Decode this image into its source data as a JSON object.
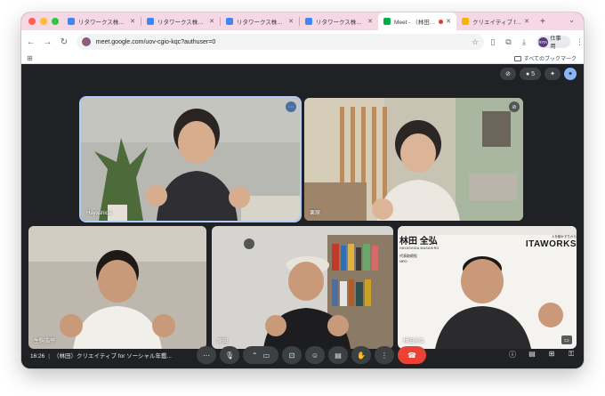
{
  "colors": {
    "tab_strip": "#f6d8e4",
    "meet_bg": "#202124",
    "control_bg": "#3c4043",
    "end_call": "#ea4335",
    "speaking_outline": "#aecbfa"
  },
  "window_controls": [
    {
      "name": "close",
      "color": "#ff5f57"
    },
    {
      "name": "minimize",
      "color": "#febc2e"
    },
    {
      "name": "zoom",
      "color": "#28c840"
    }
  ],
  "tabs": [
    {
      "label": "リタワークス株式会社 - カ",
      "favicon": "docs-icon",
      "active": false
    },
    {
      "label": "リタワークス株式会社 - カ",
      "favicon": "docs-icon",
      "active": false
    },
    {
      "label": "リタワークス株式会社 - カ",
      "favicon": "docs-icon",
      "active": false
    },
    {
      "label": "リタワークス株式会社 - カ",
      "favicon": "docs-icon",
      "active": false
    },
    {
      "label": "Meet - （林田）クリエ",
      "favicon": "meet-icon",
      "active": true
    },
    {
      "label": "クリエイティブ for ソーシャル",
      "favicon": "slides-icon",
      "active": false
    }
  ],
  "toolbar": {
    "url": "meet.google.com/uov-cgio-kqc?authuser=0",
    "profile_label": "仕事用",
    "profile_initials": "RITA"
  },
  "bookmarks": {
    "all_bookmarks_label": "すべてのブックマーク"
  },
  "meet_top": {
    "participant_count": "5"
  },
  "participants": [
    {
      "name": "Hayashida",
      "speaking": true
    },
    {
      "name": "栗原",
      "speaking": false
    },
    {
      "name": "生駒浩平",
      "speaking": false
    },
    {
      "name": "原田",
      "speaking": false
    },
    {
      "name": "林田全弘",
      "speaking": false
    }
  ],
  "presentation_text": {
    "name_kanji": "林田 全弘",
    "name_romaji": "HAYASHIDA MASAHIRO",
    "title_line1": "代表取締役",
    "title_line2": "NPO",
    "brand_fragment": "ITAWORKS",
    "tagline": "人を動かすちから"
  },
  "bottom_bar": {
    "time": "16:26",
    "meeting_title": "（林田）クリエイティブ for ソーシャル年鑑..."
  }
}
